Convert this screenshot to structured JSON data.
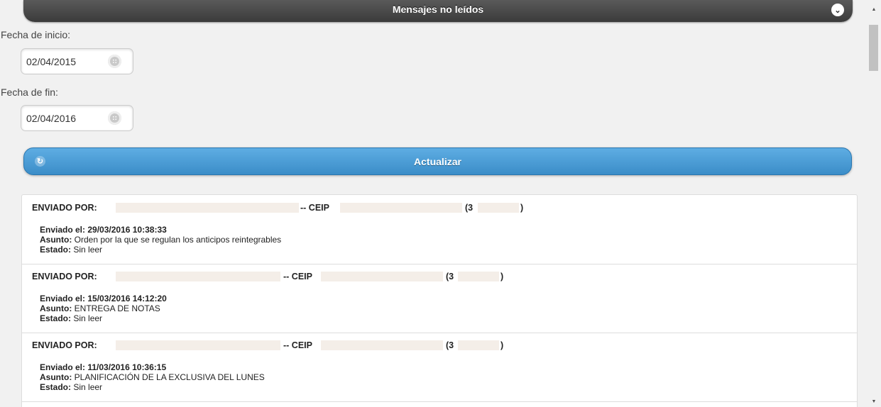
{
  "header": {
    "title": "Mensajes no leídos",
    "toggle_icon": "chevron-down-icon"
  },
  "filters": {
    "start_label": "Fecha de inicio:",
    "start_value": "02/04/2015",
    "end_label": "Fecha de fin:",
    "end_value": "02/04/2016",
    "calendar_icon": "calendar-icon"
  },
  "refresh": {
    "label": "Actualizar",
    "icon": "refresh-icon"
  },
  "messages": [
    {
      "sent_by_label": "ENVIADO POR:",
      "school_prefix": "-- CEIP",
      "paren_open": "(3",
      "paren_close": ")",
      "sent_on_label": "Enviado el:",
      "sent_on": "29/03/2016 10:38:33",
      "subject_label": "Asunto:",
      "subject": "Orden por la que se regulan los anticipos reintegrables",
      "status_label": "Estado:",
      "status": "Sin leer"
    },
    {
      "sent_by_label": "ENVIADO POR:",
      "school_prefix": "-- CEIP",
      "paren_open": "(3",
      "paren_close": ")",
      "sent_on_label": "Enviado el:",
      "sent_on": "15/03/2016 14:12:20",
      "subject_label": "Asunto:",
      "subject": "ENTREGA DE NOTAS",
      "status_label": "Estado:",
      "status": "Sin leer"
    },
    {
      "sent_by_label": "ENVIADO POR:",
      "school_prefix": "-- CEIP",
      "paren_open": "(3",
      "paren_close": ")",
      "sent_on_label": "Enviado el:",
      "sent_on": "11/03/2016 10:36:15",
      "subject_label": "Asunto:",
      "subject": "PLANIFICACIÓN DE LA EXCLUSIVA DEL LUNES",
      "status_label": "Estado:",
      "status": "Sin leer"
    }
  ]
}
